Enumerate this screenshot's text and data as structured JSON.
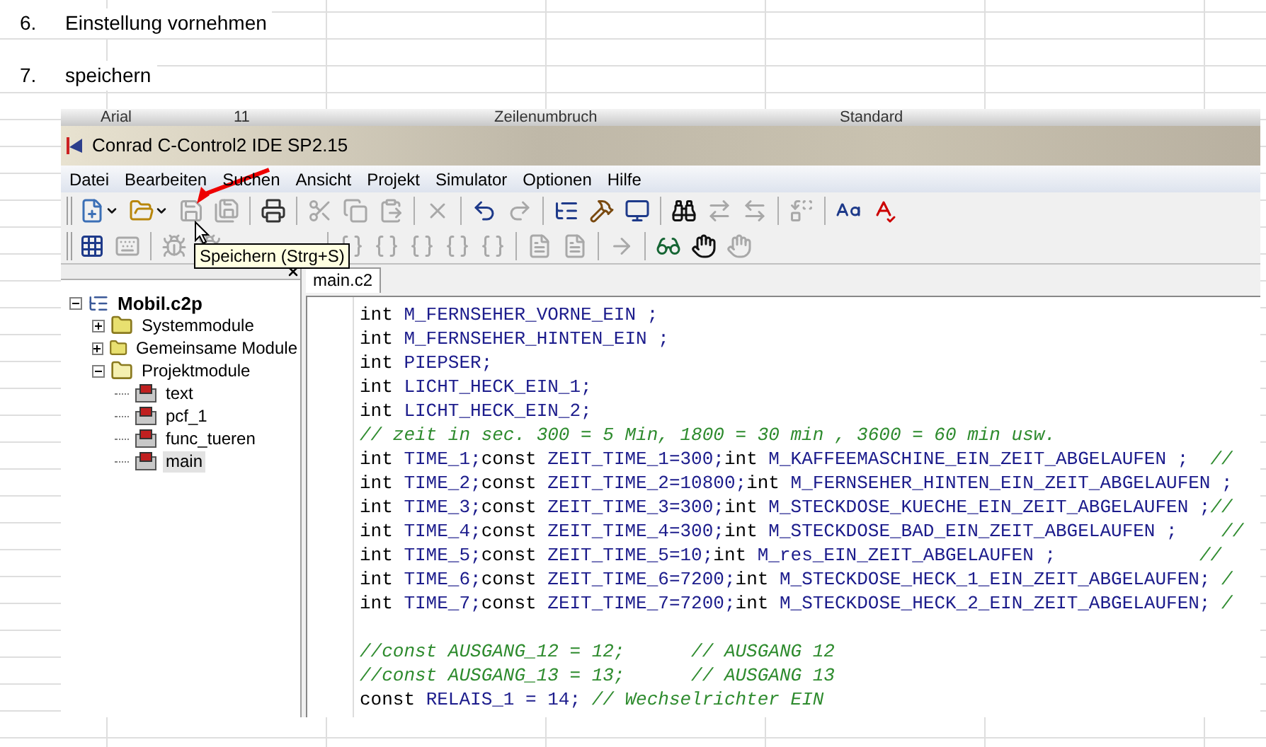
{
  "document": {
    "steps": [
      {
        "number": "6.",
        "text": "Einstellung vornehmen"
      },
      {
        "number": "7.",
        "text": "speichern"
      }
    ]
  },
  "background_ribbon": {
    "font": "Arial",
    "size": "11",
    "wrap": "Zeilenumbruch",
    "format": "Standard"
  },
  "window": {
    "title": "Conrad C-Control2 IDE SP2.15"
  },
  "menu": [
    "Datei",
    "Bearbeiten",
    "Suchen",
    "Ansicht",
    "Projekt",
    "Simulator",
    "Optionen",
    "Hilfe"
  ],
  "toolbars": [
    {
      "groups": [
        [
          {
            "disabled": false,
            "dropdown": true
          },
          {
            "disabled": false,
            "dropdown": true
          },
          {
            "disabled": true
          },
          {
            "disabled": true
          }
        ],
        [
          {
            "disabled": false
          }
        ],
        [
          {
            "disabled": true
          },
          {
            "disabled": true
          },
          {
            "disabled": true
          }
        ],
        [
          {
            "disabled": true
          }
        ],
        [
          {
            "disabled": false
          },
          {
            "disabled": true
          }
        ],
        [
          {
            "disabled": false
          },
          {
            "disabled": false
          },
          {
            "disabled": false
          }
        ],
        [
          {
            "disabled": false
          },
          {
            "disabled": true
          },
          {
            "disabled": true
          }
        ],
        [
          {
            "disabled": true
          }
        ],
        [
          {
            "disabled": false
          },
          {
            "disabled": false
          }
        ]
      ]
    },
    {
      "groups": [
        [
          {
            "disabled": false
          },
          {
            "disabled": true
          }
        ],
        [
          {
            "disabled": true
          },
          {
            "disabled": true
          }
        ],
        [
          {
            "disabled": true
          },
          {
            "disabled": true
          },
          {
            "disabled": true
          },
          {
            "disabled": true
          },
          {
            "disabled": true
          }
        ],
        [
          {
            "disabled": true
          },
          {
            "disabled": true
          }
        ],
        [
          {
            "disabled": true
          }
        ],
        [
          {
            "disabled": false
          },
          {
            "disabled": false
          },
          {
            "disabled": true
          }
        ]
      ]
    }
  ],
  "tooltip": "Speichern (Strg+S)",
  "project_tree": [
    {
      "label": "Mobil.c2p",
      "kind": "project",
      "expanded": true,
      "selected": false,
      "children": [
        {
          "label": "Systemmodule",
          "kind": "folder",
          "expanded": false,
          "selected": false
        },
        {
          "label": "Gemeinsame Module",
          "kind": "folder",
          "expanded": false,
          "selected": false
        },
        {
          "label": "Projektmodule",
          "kind": "folder",
          "expanded": true,
          "selected": false,
          "children": [
            {
              "label": "text",
              "kind": "module",
              "selected": false
            },
            {
              "label": "pcf_1",
              "kind": "module",
              "selected": false
            },
            {
              "label": "func_tueren",
              "kind": "module",
              "selected": false
            },
            {
              "label": "main",
              "kind": "module",
              "selected": true
            }
          ]
        }
      ]
    }
  ],
  "editor_tabs": [
    {
      "label": "main.c2",
      "selected": true
    }
  ],
  "code_lines": [
    {
      "kind": "code",
      "parts": [
        {
          "kind": "keyword",
          "text": "int"
        },
        {
          "kind": "plain",
          "text": " M_FERNSEHER_VORNE_EIN ;"
        }
      ]
    },
    {
      "kind": "code",
      "parts": [
        {
          "kind": "keyword",
          "text": "int"
        },
        {
          "kind": "plain",
          "text": " M_FERNSEHER_HINTEN_EIN ;"
        }
      ]
    },
    {
      "kind": "code",
      "parts": [
        {
          "kind": "keyword",
          "text": "int"
        },
        {
          "kind": "plain",
          "text": " PIEPSER;"
        }
      ]
    },
    {
      "kind": "code",
      "parts": [
        {
          "kind": "keyword",
          "text": "int"
        },
        {
          "kind": "plain",
          "text": " LICHT_HECK_EIN_1;"
        }
      ]
    },
    {
      "kind": "code",
      "parts": [
        {
          "kind": "keyword",
          "text": "int"
        },
        {
          "kind": "plain",
          "text": " LICHT_HECK_EIN_2;"
        }
      ]
    },
    {
      "kind": "code",
      "parts": [
        {
          "kind": "comment",
          "text": "// zeit in sec. 300 = 5 Min, 1800 = 30 min , 3600 = 60 min usw."
        }
      ]
    },
    {
      "kind": "code",
      "parts": [
        {
          "kind": "keyword",
          "text": "int"
        },
        {
          "kind": "plain",
          "text": " TIME_1;"
        },
        {
          "kind": "keyword",
          "text": "const"
        },
        {
          "kind": "plain",
          "text": " ZEIT_TIME_1=300;"
        },
        {
          "kind": "keyword",
          "text": "int"
        },
        {
          "kind": "plain",
          "text": " M_KAFFEEMASCHINE_EIN_ZEIT_ABGELAUFEN ;  "
        },
        {
          "kind": "comment",
          "text": "//"
        }
      ]
    },
    {
      "kind": "code",
      "parts": [
        {
          "kind": "keyword",
          "text": "int"
        },
        {
          "kind": "plain",
          "text": " TIME_2;"
        },
        {
          "kind": "keyword",
          "text": "const"
        },
        {
          "kind": "plain",
          "text": " ZEIT_TIME_2=10800;"
        },
        {
          "kind": "keyword",
          "text": "int"
        },
        {
          "kind": "plain",
          "text": " M_FERNSEHER_HINTEN_EIN_ZEIT_ABGELAUFEN ;"
        }
      ]
    },
    {
      "kind": "code",
      "parts": [
        {
          "kind": "keyword",
          "text": "int"
        },
        {
          "kind": "plain",
          "text": " TIME_3;"
        },
        {
          "kind": "keyword",
          "text": "const"
        },
        {
          "kind": "plain",
          "text": " ZEIT_TIME_3=300;"
        },
        {
          "kind": "keyword",
          "text": "int"
        },
        {
          "kind": "plain",
          "text": " M_STECKDOSE_KUECHE_EIN_ZEIT_ABGELAUFEN ;"
        },
        {
          "kind": "comment",
          "text": "//"
        }
      ]
    },
    {
      "kind": "code",
      "parts": [
        {
          "kind": "keyword",
          "text": "int"
        },
        {
          "kind": "plain",
          "text": " TIME_4;"
        },
        {
          "kind": "keyword",
          "text": "const"
        },
        {
          "kind": "plain",
          "text": " ZEIT_TIME_4=300;"
        },
        {
          "kind": "keyword",
          "text": "int"
        },
        {
          "kind": "plain",
          "text": " M_STECKDOSE_BAD_EIN_ZEIT_ABGELAUFEN ;    "
        },
        {
          "kind": "comment",
          "text": "//"
        }
      ]
    },
    {
      "kind": "code",
      "parts": [
        {
          "kind": "keyword",
          "text": "int"
        },
        {
          "kind": "plain",
          "text": " TIME_5;"
        },
        {
          "kind": "keyword",
          "text": "const"
        },
        {
          "kind": "plain",
          "text": " ZEIT_TIME_5=10;"
        },
        {
          "kind": "keyword",
          "text": "int"
        },
        {
          "kind": "plain",
          "text": " M_res_EIN_ZEIT_ABGELAUFEN ;             "
        },
        {
          "kind": "comment",
          "text": "//"
        }
      ]
    },
    {
      "kind": "code",
      "parts": [
        {
          "kind": "keyword",
          "text": "int"
        },
        {
          "kind": "plain",
          "text": " TIME_6;"
        },
        {
          "kind": "keyword",
          "text": "const"
        },
        {
          "kind": "plain",
          "text": " ZEIT_TIME_6=7200;"
        },
        {
          "kind": "keyword",
          "text": "int"
        },
        {
          "kind": "plain",
          "text": " M_STECKDOSE_HECK_1_EIN_ZEIT_ABGELAUFEN; "
        },
        {
          "kind": "comment",
          "text": "/"
        }
      ]
    },
    {
      "kind": "code",
      "parts": [
        {
          "kind": "keyword",
          "text": "int"
        },
        {
          "kind": "plain",
          "text": " TIME_7;"
        },
        {
          "kind": "keyword",
          "text": "const"
        },
        {
          "kind": "plain",
          "text": " ZEIT_TIME_7=7200;"
        },
        {
          "kind": "keyword",
          "text": "int"
        },
        {
          "kind": "plain",
          "text": " M_STECKDOSE_HECK_2_EIN_ZEIT_ABGELAUFEN; "
        },
        {
          "kind": "comment",
          "text": "/"
        }
      ]
    },
    {
      "kind": "blank"
    },
    {
      "kind": "code",
      "parts": [
        {
          "kind": "comment",
          "text": "//const AUSGANG_12 = 12;      // AUSGANG 12"
        }
      ]
    },
    {
      "kind": "code",
      "parts": [
        {
          "kind": "comment",
          "text": "//const AUSGANG_13 = 13;      // AUSGANG 13"
        }
      ]
    },
    {
      "kind": "code",
      "parts": [
        {
          "kind": "keyword",
          "text": "const"
        },
        {
          "kind": "plain",
          "text": " RELAIS_1 = 14; "
        },
        {
          "kind": "comment",
          "text": "// Wechselrichter EIN"
        }
      ]
    }
  ]
}
